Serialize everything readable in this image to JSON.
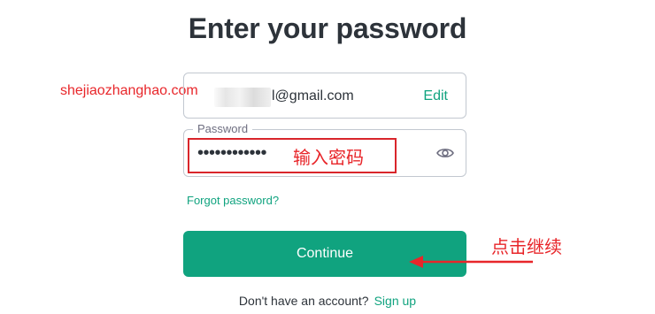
{
  "title": "Enter your password",
  "watermark": "shejiaozhanghao.com",
  "email": {
    "value_suffix": "l@gmail.com",
    "edit_label": "Edit"
  },
  "password": {
    "label": "Password",
    "masked_value": "••••••••••••",
    "toggle_icon": "eye-icon"
  },
  "forgot_password": "Forgot password?",
  "continue_label": "Continue",
  "signup": {
    "prompt": "Don't have an account?",
    "link": "Sign up"
  },
  "annotations": {
    "password_hint": "输入密码",
    "continue_hint": "点击继续"
  },
  "colors": {
    "accent": "#10a37f",
    "annotation": "#e8262a",
    "text": "#2d333a",
    "border": "#c2c8d0"
  }
}
